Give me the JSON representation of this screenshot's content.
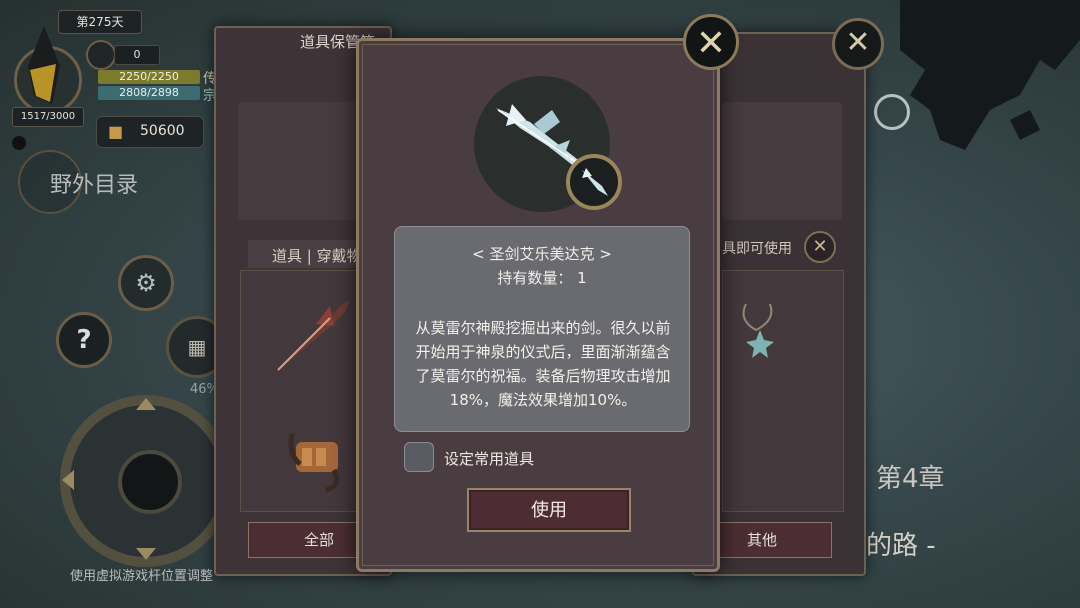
{
  "hud": {
    "day": "第275天",
    "calendar_count": "0",
    "hp": "2250/2250",
    "mp": "2808/2898",
    "hp_label": "传",
    "mp_label": "宗",
    "exp": "1517/3000",
    "gold": "50600",
    "field_catalog": "野外目录",
    "help_symbol": "?",
    "progress_percent": "46%",
    "hint": "使用虚拟游戏杆位置调整",
    "chapter": "第4章",
    "chapter_subtitle": "巢的路 -"
  },
  "back_panel": {
    "title": "道具保管箱",
    "tab_label": "道具 | 穿戴物",
    "usage_hint": "具即可使用",
    "filter_all": "全部",
    "filter_other": "其他"
  },
  "modal": {
    "item_name": "< 圣剑艾乐美达克 >",
    "item_count": "持有数量： 1",
    "item_description": "从莫雷尔神殿挖掘出来的剑。很久以前开始用于神泉的仪式后，里面渐渐蕴含了莫雷尔的祝福。装备后物理攻击增加18%，魔法效果增加10%。",
    "favorite_label": "设定常用道具",
    "favorite_checked": false,
    "use_button": "使用"
  },
  "colors": {
    "accent_gold": "#8c7a58",
    "button_red": "#4d2d33",
    "panel_bg": "#4a3d41",
    "hp_bar": "#7c7a2c",
    "mp_bar": "#3d6b72"
  },
  "icons": {
    "close": "close-x-icon",
    "gold": "gold-bag-icon",
    "gear": "gear-icon",
    "calendar": "calendar-icon",
    "crystal": "crystal-icon",
    "sword": "sword-icon"
  }
}
